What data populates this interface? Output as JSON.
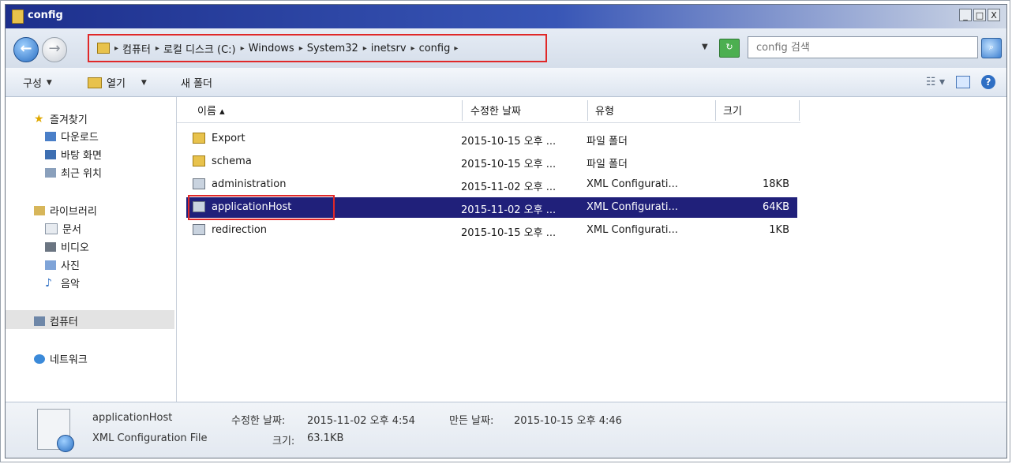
{
  "window": {
    "title": "config",
    "min": "_",
    "max": "□",
    "close": "X"
  },
  "address": {
    "crumbs": [
      "컴퓨터",
      "로컬 디스크 (C:)",
      "Windows",
      "System32",
      "inetsrv",
      "config"
    ]
  },
  "search": {
    "placeholder": "config 검색"
  },
  "toolbar": {
    "organize": "구성",
    "open": "열기",
    "new_folder": "새 폴더"
  },
  "nav": {
    "favorites": "즐겨찾기",
    "downloads": "다운로드",
    "desktop": "바탕 화면",
    "recent": "최근 위치",
    "libraries": "라이브러리",
    "documents": "문서",
    "videos": "비디오",
    "pictures": "사진",
    "music": "음악",
    "computer": "컴퓨터",
    "network": "네트워크"
  },
  "columns": {
    "name": "이름",
    "modified": "수정한 날짜",
    "type": "유형",
    "size": "크기"
  },
  "files": [
    {
      "name": "Export",
      "modified": "2015-10-15 오후 ...",
      "type": "파일 폴더",
      "size": "",
      "kind": "folder"
    },
    {
      "name": "schema",
      "modified": "2015-10-15 오후 ...",
      "type": "파일 폴더",
      "size": "",
      "kind": "folder"
    },
    {
      "name": "administration",
      "modified": "2015-11-02 오후 ...",
      "type": "XML Configurati...",
      "size": "18KB",
      "kind": "xml"
    },
    {
      "name": "applicationHost",
      "modified": "2015-11-02 오후 ...",
      "type": "XML Configurati...",
      "size": "64KB",
      "kind": "xml"
    },
    {
      "name": "redirection",
      "modified": "2015-10-15 오후 ...",
      "type": "XML Configurati...",
      "size": "1KB",
      "kind": "xml"
    }
  ],
  "selected_file": "applicationHost",
  "details": {
    "name": "applicationHost",
    "type": "XML Configuration File",
    "modified_label": "수정한 날짜:",
    "modified": "2015-11-02 오후 4:54",
    "created_label": "만든 날짜:",
    "created": "2015-10-15 오후 4:46",
    "size_label": "크기:",
    "size": "63.1KB"
  }
}
